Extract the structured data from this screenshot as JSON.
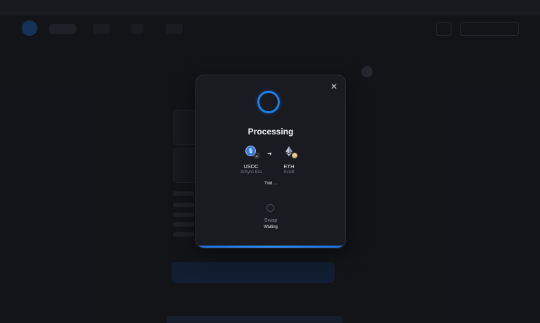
{
  "modal": {
    "title": "Processing",
    "close_icon": "close-icon",
    "from_token": {
      "symbol": "USDC",
      "network": "zkSync Era",
      "icon": "usdc-icon",
      "badge": "zksync-icon"
    },
    "to_token": {
      "symbol": "ETH",
      "network": "Scroll",
      "icon": "eth-icon",
      "badge": "scroll-icon"
    },
    "arrow_icon": "arrow-right-icon",
    "txid": "Txid ...",
    "step": {
      "label": "Swap",
      "status": "Waiting"
    },
    "accent_color": "#1e7fe6"
  }
}
